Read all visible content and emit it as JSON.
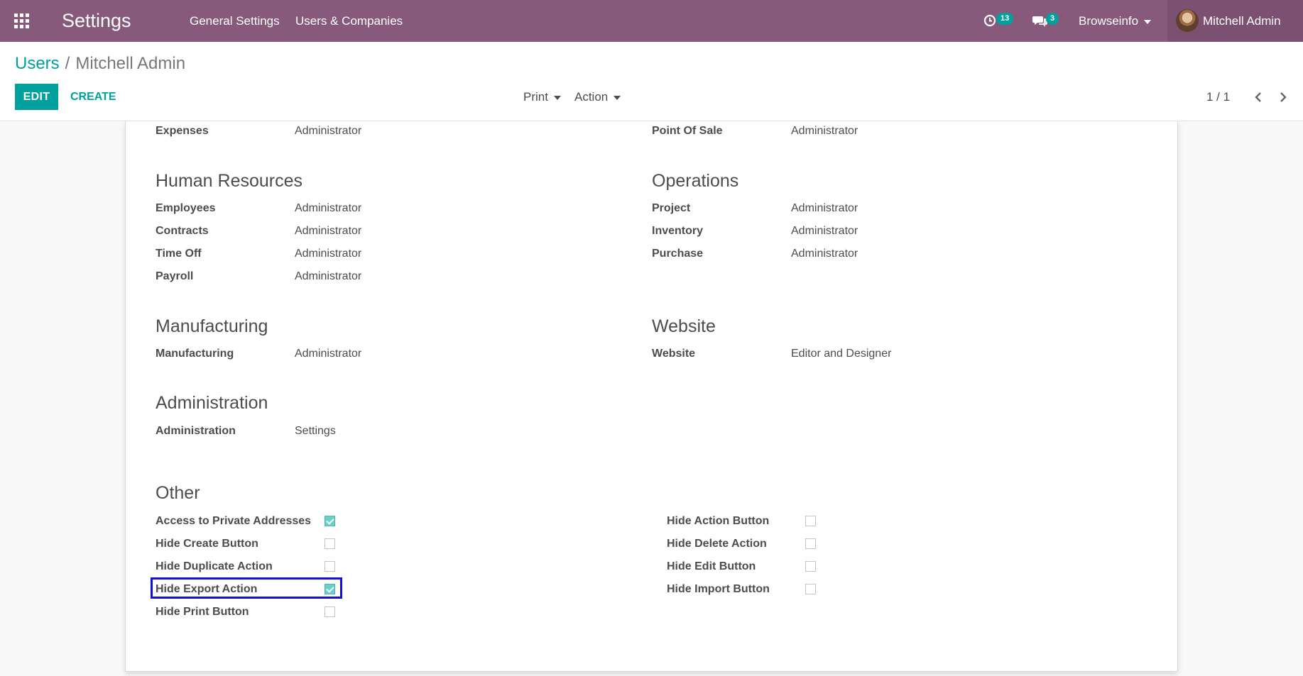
{
  "navbar": {
    "app_title": "Settings",
    "menu": [
      "General Settings",
      "Users & Companies"
    ],
    "activity_count": "13",
    "message_count": "3",
    "company": "Browseinfo",
    "user_name": "Mitchell Admin",
    "icons": [
      "apps-grid-icon",
      "clock-icon",
      "chat-bubbles-icon",
      "caret-down-icon"
    ]
  },
  "control_panel": {
    "breadcrumb": {
      "parent": "Users",
      "separator": "/",
      "current": "Mitchell Admin"
    },
    "edit_label": "EDIT",
    "create_label": "CREATE",
    "print_label": "Print",
    "action_label": "Action",
    "pager": "1 / 1"
  },
  "colors": {
    "navbar": "#875a7b",
    "accent": "#00a09d",
    "highlight": "#1010d8"
  },
  "form": {
    "top_left": {
      "label": "Expenses",
      "value": "Administrator"
    },
    "top_right": {
      "label": "Point Of Sale",
      "value": "Administrator"
    },
    "human_resources": {
      "title": "Human Resources",
      "rows": [
        {
          "label": "Employees",
          "value": "Administrator"
        },
        {
          "label": "Contracts",
          "value": "Administrator"
        },
        {
          "label": "Time Off",
          "value": "Administrator"
        },
        {
          "label": "Payroll",
          "value": "Administrator"
        }
      ]
    },
    "operations": {
      "title": "Operations",
      "rows": [
        {
          "label": "Project",
          "value": "Administrator"
        },
        {
          "label": "Inventory",
          "value": "Administrator"
        },
        {
          "label": "Purchase",
          "value": "Administrator"
        }
      ]
    },
    "manufacturing": {
      "title": "Manufacturing",
      "rows": [
        {
          "label": "Manufacturing",
          "value": "Administrator"
        }
      ]
    },
    "website": {
      "title": "Website",
      "rows": [
        {
          "label": "Website",
          "value": "Editor and Designer"
        }
      ]
    },
    "administration": {
      "title": "Administration",
      "rows": [
        {
          "label": "Administration",
          "value": "Settings"
        }
      ]
    },
    "other": {
      "title": "Other",
      "left": [
        {
          "label": "Access to Private Addresses",
          "checked": true
        },
        {
          "label": "Hide Create Button",
          "checked": false
        },
        {
          "label": "Hide Duplicate Action",
          "checked": false
        },
        {
          "label": "Hide Export Action",
          "checked": true
        },
        {
          "label": "Hide Print Button",
          "checked": false
        }
      ],
      "right": [
        {
          "label": "Hide Action Button",
          "checked": false
        },
        {
          "label": "Hide Delete Action",
          "checked": false
        },
        {
          "label": "Hide Edit Button",
          "checked": false
        },
        {
          "label": "Hide Import Button",
          "checked": false
        }
      ]
    }
  }
}
